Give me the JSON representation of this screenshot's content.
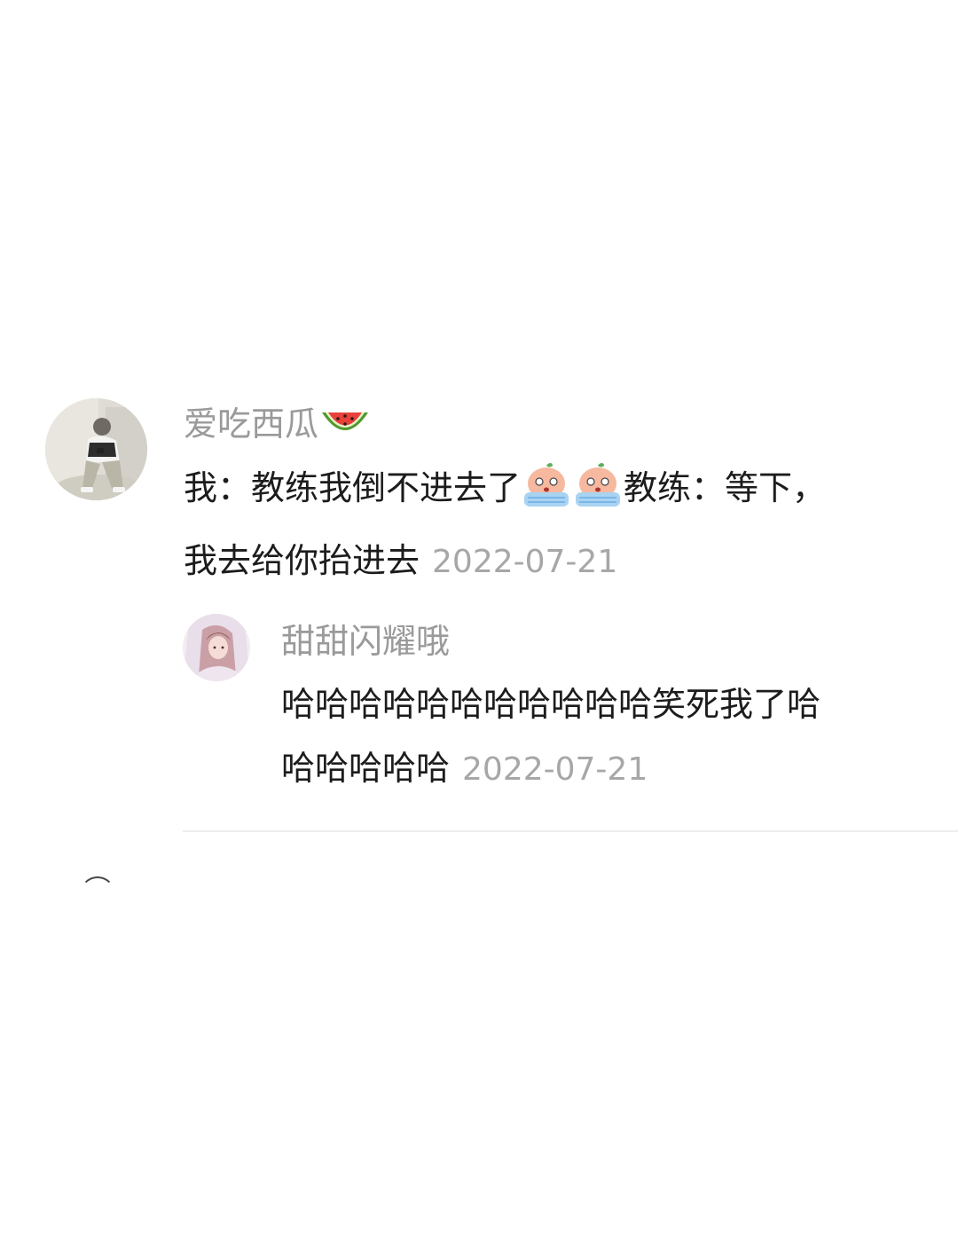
{
  "comment": {
    "username": "爱吃西瓜",
    "username_emoji": "watermelon-emoji",
    "text_line1_before": "我：教练我倒不进去了",
    "emojis": [
      "crying-peach-emoji",
      "crying-peach-emoji"
    ],
    "text_line1_after": "教练：等下，",
    "text_line2": "我去给你抬进去",
    "date": "2022-07-21",
    "avatar": "user-avatar-man-sitting"
  },
  "reply": {
    "username": "甜甜闪耀哦",
    "text_line1": "哈哈哈哈哈哈哈哈哈哈哈笑死我了哈",
    "text_line2": "哈哈哈哈哈",
    "date": "2022-07-21",
    "avatar": "user-avatar-woman"
  },
  "colors": {
    "username": "#9a9a9a",
    "text": "#1c1c1c",
    "date": "#a7a7a7",
    "divider": "#ededed"
  }
}
